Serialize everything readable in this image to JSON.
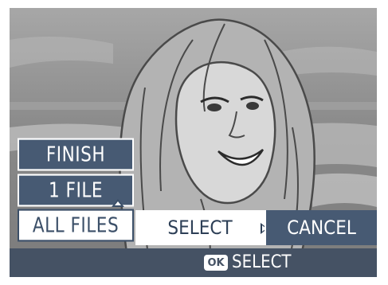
{
  "photo": {
    "subject_icon": "portrait-photo-icon"
  },
  "menu": {
    "items": [
      {
        "label": "FINISH",
        "selected": false
      },
      {
        "label": "1 FILE",
        "selected": false
      },
      {
        "label": "ALL FILES",
        "selected": true
      }
    ]
  },
  "action_bar": {
    "select_label": "SELECT",
    "cancel_label": "CANCEL"
  },
  "status_bar": {
    "ok_icon_label": "OK",
    "hint_label": "SELECT"
  },
  "colors": {
    "menu_background": "#475a73",
    "status_bar": "#455264",
    "highlight": "#ffffff"
  }
}
